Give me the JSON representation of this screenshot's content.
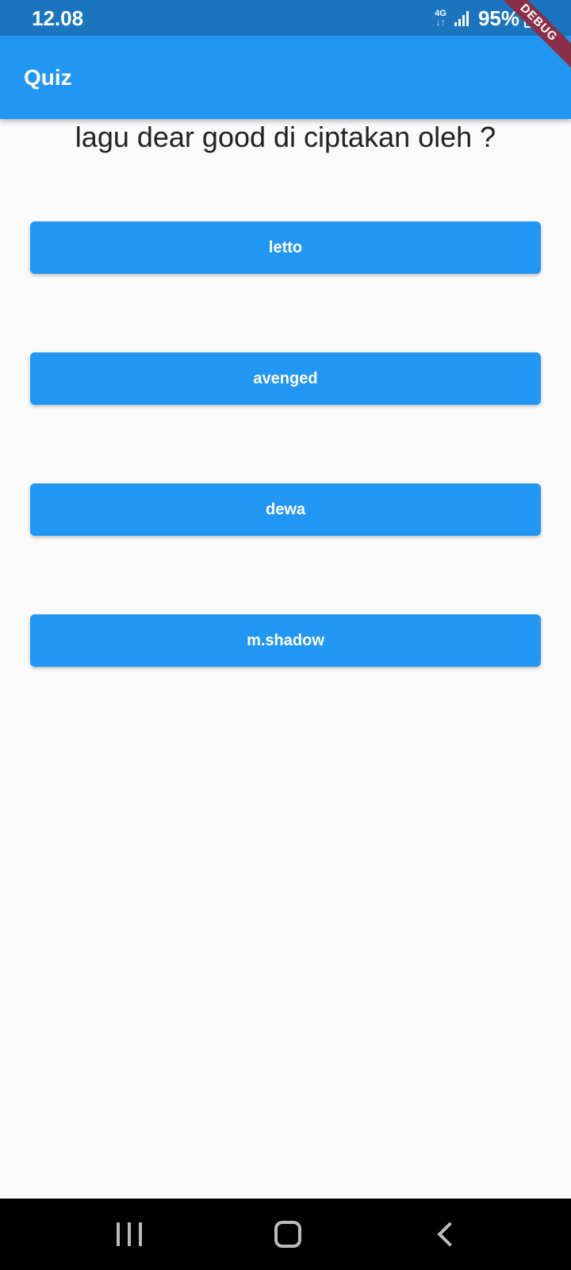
{
  "status_bar": {
    "time": "12.08",
    "network": "4G",
    "battery": "95%",
    "debug": "DEBUG"
  },
  "app_bar": {
    "title": "Quiz"
  },
  "quiz": {
    "question": "lagu dear good di ciptakan oleh ?",
    "answers": [
      "letto",
      "avenged",
      "dewa",
      "m.shadow"
    ]
  },
  "nav_bar": {
    "icons": [
      "recents-icon",
      "home-icon",
      "back-icon"
    ]
  },
  "colors": {
    "primary": "#2196f3",
    "status_bar": "#1a75be",
    "background": "#fafafa"
  }
}
